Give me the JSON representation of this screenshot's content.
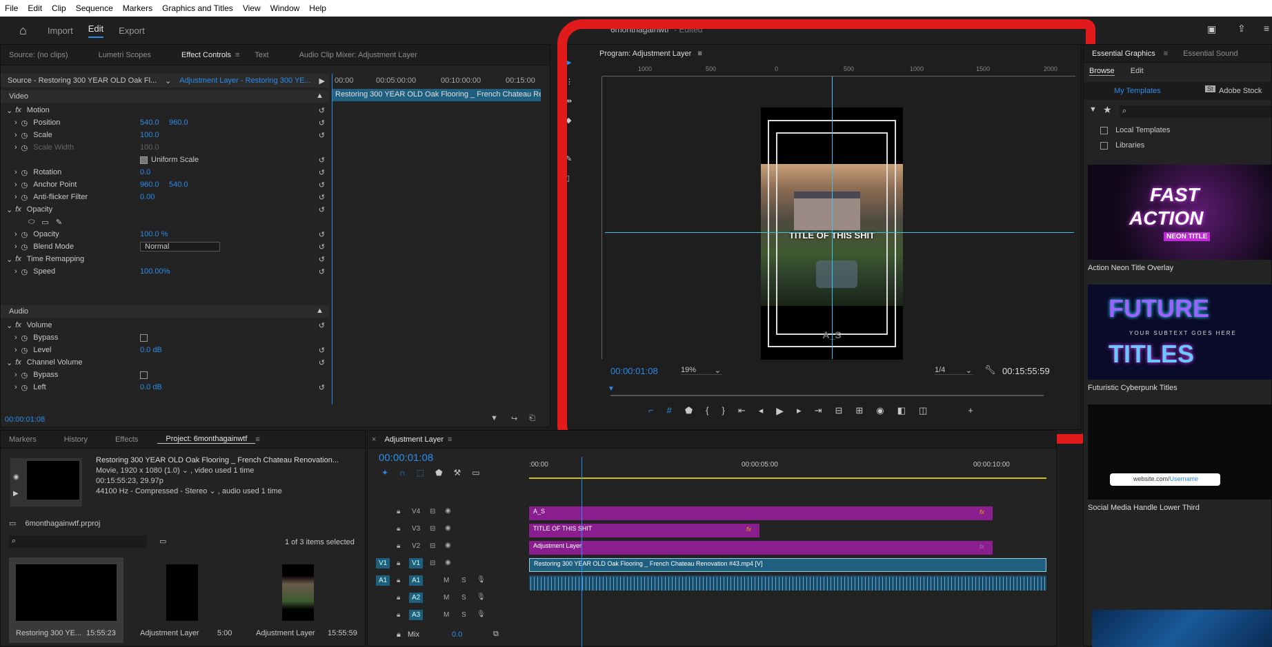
{
  "menu": [
    "File",
    "Edit",
    "Clip",
    "Sequence",
    "Markers",
    "Graphics and Titles",
    "View",
    "Window",
    "Help"
  ],
  "workspace": {
    "tabs": [
      "Import",
      "Edit",
      "Export"
    ],
    "project_title": "6monthagainwtf",
    "edited": "- Edited"
  },
  "source_panel": {
    "tabs": [
      "Source: (no clips)",
      "Lumetri Scopes",
      "Effect Controls",
      "Text",
      "Audio Clip Mixer: Adjustment Layer"
    ],
    "source_label": "Source - Restoring 300 YEAR OLD Oak Fl...",
    "target_label": "Adjustment Layer - Restoring 300 YE...",
    "ruler": [
      "00:00",
      "00:05:00:00",
      "00:10:00:00",
      "00:15:00"
    ],
    "clip_label": "Restoring 300 YEAR OLD Oak Flooring _ French Chateau Re",
    "video_header": "Video",
    "audio_header": "Audio",
    "timecode": "00:00:01:08",
    "rows": [
      {
        "name": "Motion",
        "fx": true
      },
      {
        "name": "Position",
        "v1": "540.0",
        "v2": "960.0"
      },
      {
        "name": "Scale",
        "v1": "100.0"
      },
      {
        "name": "Scale Width",
        "v1": "100.0",
        "dim": true
      },
      {
        "name": "Uniform Scale",
        "check": true
      },
      {
        "name": "Rotation",
        "v1": "0.0"
      },
      {
        "name": "Anchor Point",
        "v1": "960.0",
        "v2": "540.0"
      },
      {
        "name": "Anti-flicker Filter",
        "v1": "0.00"
      },
      {
        "name": "Opacity",
        "fx": true
      },
      {
        "name": "shapes"
      },
      {
        "name": "Opacity",
        "v1": "100.0 %"
      },
      {
        "name": "Blend Mode",
        "select": "Normal"
      },
      {
        "name": "Time Remapping",
        "fx": true
      },
      {
        "name": "Speed",
        "v1": "100.00%"
      }
    ],
    "audio_rows": [
      {
        "name": "Volume",
        "fx": true
      },
      {
        "name": "Bypass",
        "checkbox": true
      },
      {
        "name": "Level",
        "v1": "0.0 dB"
      },
      {
        "name": "Channel Volume",
        "fx": true
      },
      {
        "name": "Bypass",
        "checkbox": true
      },
      {
        "name": "Left",
        "v1": "0.0 dB"
      }
    ]
  },
  "program": {
    "title": "Program: Adjustment Layer",
    "ruler": [
      "1000",
      "500",
      "0",
      "500",
      "1000",
      "1500",
      "2000"
    ],
    "title_text": "TITLE OF THIS SHIT",
    "watermark": "A_S",
    "timecode": "00:00:01:08",
    "zoom": "19%",
    "resolution": "1/4",
    "duration": "00:15:55:59"
  },
  "essential_graphics": {
    "tabs": [
      "Essential Graphics",
      "Essential Sound"
    ],
    "subtabs": [
      "Browse",
      "Edit"
    ],
    "sources": [
      "My Templates",
      "Adobe Stock"
    ],
    "checkboxes": [
      "Local Templates",
      "Libraries"
    ],
    "templates": [
      {
        "name": "Action Neon Title Overlay",
        "line1": "FAST",
        "line2": "ACTION",
        "line3": "NEON TITLE"
      },
      {
        "name": "Futuristic Cyberpunk Titles",
        "line1": "FUTURE",
        "line2": "YOUR SUBTEXT GOES HERE",
        "line3": "TITLES"
      },
      {
        "name": "Social Media Handle Lower Third",
        "line1": "website.com/",
        "line2": "Username"
      }
    ]
  },
  "project_panel": {
    "tabs": [
      "Markers",
      "History",
      "Effects",
      "Project: 6monthagainwtf"
    ],
    "clip_name": "Restoring 300 YEAR OLD Oak Flooring _ French Chateau Renovation...",
    "meta1": "Movie, 1920 x 1080 (1.0)",
    "meta1b": ", video used 1 time",
    "meta2": "00:15:55:23, 29.97p",
    "meta3": "44100 Hz - Compressed - Stereo",
    "meta3b": ", audio used 1 time",
    "project_file": "6monthagainwtf.prproj",
    "selected": "1 of 3 items selected",
    "items": [
      {
        "name": "Restoring 300 YE...",
        "duration": "15:55:23"
      },
      {
        "name": "Adjustment Layer",
        "duration": "5:00"
      },
      {
        "name": "Adjustment Layer",
        "duration": "15:55:59"
      }
    ]
  },
  "timeline": {
    "tab": "Adjustment Layer",
    "timecode": "00:00:01:08",
    "ruler": [
      ":00:00",
      "00:00:05:00",
      "00:00:10:00"
    ],
    "tracks": [
      {
        "label": "V4",
        "clip": "A_S"
      },
      {
        "label": "V3",
        "clip": "TITLE OF THIS SHIT"
      },
      {
        "label": "V2",
        "clip": "Adjustment Layer"
      },
      {
        "label": "V1",
        "clip": "Restoring 300 YEAR OLD Oak Flooring _ French Chateau Renovation #43.mp4 [V]"
      },
      {
        "label": "A1"
      },
      {
        "label": "A2"
      },
      {
        "label": "A3"
      }
    ],
    "source_v": "V1",
    "source_a": "A1",
    "mix_label": "Mix",
    "mix_value": "0.0"
  }
}
